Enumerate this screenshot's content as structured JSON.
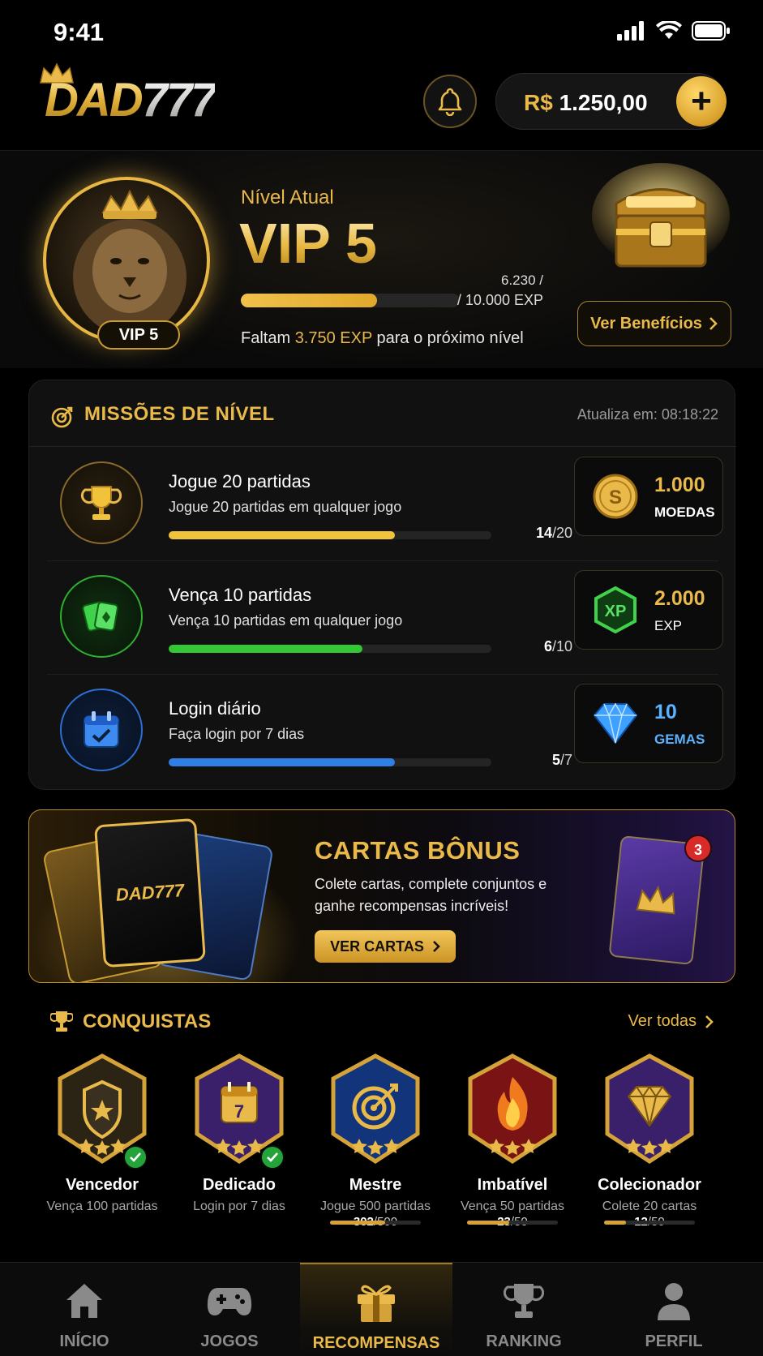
{
  "status_bar": {
    "time": "9:41"
  },
  "header": {
    "logo_main": "DAD",
    "logo_num": "777",
    "balance_currency": "R$",
    "balance_value": "1.250,00",
    "add_label": "+"
  },
  "vip": {
    "badge": "VIP 5",
    "level_label": "Nível Atual",
    "level_value": "VIP 5",
    "xp_current": "6.230 /",
    "xp_max": "/ 10.000 EXP",
    "progress_fraction": 0.623,
    "remaining_prefix": "Faltam",
    "remaining_value": "3.750 EXP",
    "remaining_suffix": "para o próximo nível",
    "benefits_button": "Ver Benefícios"
  },
  "missions": {
    "title": "MISSÕES DE NÍVEL",
    "timer": "Atualiza em: 08:18:22",
    "items": [
      {
        "title": "Jogue 20 partidas",
        "desc": "Jogue 20 partidas em qualquer jogo",
        "done": "14",
        "total": "/20",
        "progress": 0.7,
        "color": "#f0c33a",
        "reward_amount": "1.000",
        "reward_unit": "MOEDAS",
        "icon": "trophy-icon"
      },
      {
        "title": "Vença 10 partidas",
        "desc": "Vença 10 partidas em qualquer jogo",
        "done": "6",
        "total": "/10",
        "progress": 0.6,
        "color": "#34c734",
        "reward_amount": "2.000",
        "reward_unit": "EXP",
        "icon": "cards-icon"
      },
      {
        "title": "Login diário",
        "desc": "Faça login por 7 dias",
        "done": "5",
        "total": "/7",
        "progress": 0.7,
        "color": "#2f7fe6",
        "reward_amount": "10",
        "reward_unit": "GEMAS",
        "icon": "calendar-icon"
      }
    ]
  },
  "cards_banner": {
    "title": "CARTAS BÔNUS",
    "desc": "Colete cartas, complete conjuntos e ganhe recompensas incríveis!",
    "button": "VER CARTAS",
    "card_logo": "DAD777",
    "badge_count": "3"
  },
  "achievements": {
    "title": "CONQUISTAS",
    "see_all": "Ver todas",
    "items": [
      {
        "name": "Vencedor",
        "desc": "Vença 100 partidas",
        "completed": true
      },
      {
        "name": "Dedicado",
        "desc": "Login por 7 dias",
        "completed": true,
        "day": "7"
      },
      {
        "name": "Mestre",
        "desc": "Jogue 500 partidas",
        "done": "302",
        "total": "/500",
        "progress": 0.604
      },
      {
        "name": "Imbatível",
        "desc": "Vença 50 partidas",
        "done": "23",
        "total": "/50",
        "progress": 0.46
      },
      {
        "name": "Colecionador",
        "desc": "Colete 20 cartas",
        "done": "12",
        "total": "/50",
        "progress": 0.24
      }
    ]
  },
  "nav": {
    "items": [
      {
        "label": "INÍCIO",
        "icon": "home-icon"
      },
      {
        "label": "JOGOS",
        "icon": "gamepad-icon"
      },
      {
        "label": "RECOMPENSAS",
        "icon": "gift-icon",
        "active": true
      },
      {
        "label": "RANKING",
        "icon": "trophy-icon"
      },
      {
        "label": "PERFIL",
        "icon": "user-icon"
      }
    ]
  },
  "colors": {
    "gold": "#e9b949",
    "green": "#34c734",
    "blue": "#2f7fe6",
    "background": "#000000"
  }
}
